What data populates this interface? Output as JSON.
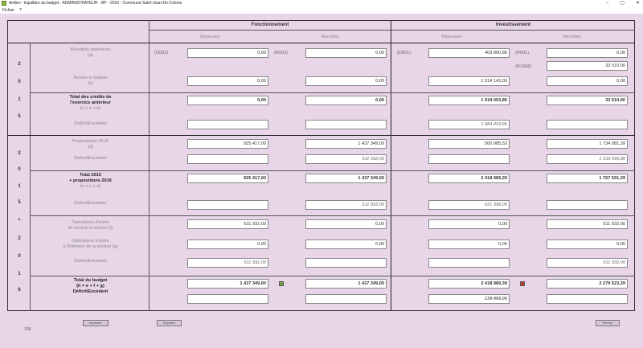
{
  "window": {
    "title": "Ambre - Equilibre du budget - ADMINISTRATEUR - BP - 2016 - Commune Saint-Jean-De-Coloris",
    "minimize": "–",
    "maximize": "▢",
    "close": "✕"
  },
  "menu": {
    "file": "Fichier",
    "help": "?"
  },
  "header": {
    "fonctionnement": "Fonctionnement",
    "investissement": "Investissement",
    "depenses": "Dépenses",
    "recettes": "Recettes"
  },
  "year_labels": {
    "a1": "2",
    "a2": "0",
    "a3": "1",
    "a4": "5",
    "b1": "2",
    "b2": "0",
    "b3": "1",
    "b4": "5",
    "b5": "+",
    "b6": "2",
    "b7": "0",
    "b8": "1",
    "b9": "6"
  },
  "codes": {
    "d002": "(D002)",
    "r002": "(R002)",
    "d001": "(D001)",
    "r001": "(R001)",
    "r1068": "(R1068)"
  },
  "rows": {
    "resultats": {
      "l1": "Résultats antérieurs",
      "l2": "(a)",
      "fd": "0,00",
      "fr": "0,00",
      "id": "403 860,86",
      "ir": "0,00",
      "ir2": "33 510,00"
    },
    "restes": {
      "l1": "Restes à réaliser",
      "l2": "(b)",
      "fd": "0,00",
      "fr": "0,00",
      "id": "1 514 143,00",
      "ir": "0,00"
    },
    "total_ant": {
      "l1": "Total des crédits de",
      "l2": "l'exercice antérieur",
      "l3": "(c = a + b)",
      "fd": "0,00",
      "fr": "0,00",
      "id": "1 918 003,86",
      "ir": "33 510,00"
    },
    "deficit1": {
      "l1": "Déficit/Excédent",
      "fd": "",
      "fr": "",
      "id": "1 884 493,86",
      "ir": ""
    },
    "propositions": {
      "l1": "Propositions 2016",
      "l2": "(d)",
      "fd": "925 417,00",
      "fr": "1 437 349,00",
      "id": "500 985,53",
      "ir": "1 734 081,39"
    },
    "deficit2": {
      "l1": "Déficit/Excédent",
      "fd": "",
      "fr": "511 932,00",
      "id": "",
      "ir": "1 233 095,86"
    },
    "total2015": {
      "l1": "Total 2015",
      "l2": "+ propositions 2016",
      "l3": "(e = c + d)",
      "fd": "925 417,00",
      "fr": "1 437 349,00",
      "id": "2 418 989,39",
      "ir": "1 767 591,39"
    },
    "deficit3": {
      "l1": "Déficit/Excédent",
      "fd": "",
      "fr": "511 932,00",
      "id": "651 398,00",
      "ir": ""
    },
    "ordre_f": {
      "l1": "Opérations d'ordre",
      "l2": "de section à section (f)",
      "fd": "511 932,00",
      "fr": "0,00",
      "id": "0,00",
      "ir": "511 932,00"
    },
    "ordre_g": {
      "l1": "Opérations d'ordre",
      "l2": "à l'intérieur de la section (g)",
      "fd": "0,00",
      "fr": "0,00",
      "id": "0,00",
      "ir": "0,00"
    },
    "deficit4": {
      "l1": "Déficit/Excédent",
      "fd": "511 932,00",
      "fr": "",
      "id": "",
      "ir": "511 932,00"
    },
    "total_budget": {
      "l1": "Total du budget",
      "l2": "(h = e + f + g)",
      "l3": "Déficit/Excédent",
      "fd": "1 437 349,00",
      "fr": "1 437 349,00",
      "id": "2 418 989,39",
      "ir": "2 279 523,39",
      "fd2": "",
      "fr2": "",
      "id2": "139 466,00",
      "ir2": ""
    }
  },
  "buttons": {
    "imprimer": "Imprimer",
    "exporter": "Exporter",
    "fermer": "Fermer"
  },
  "footer": "198"
}
